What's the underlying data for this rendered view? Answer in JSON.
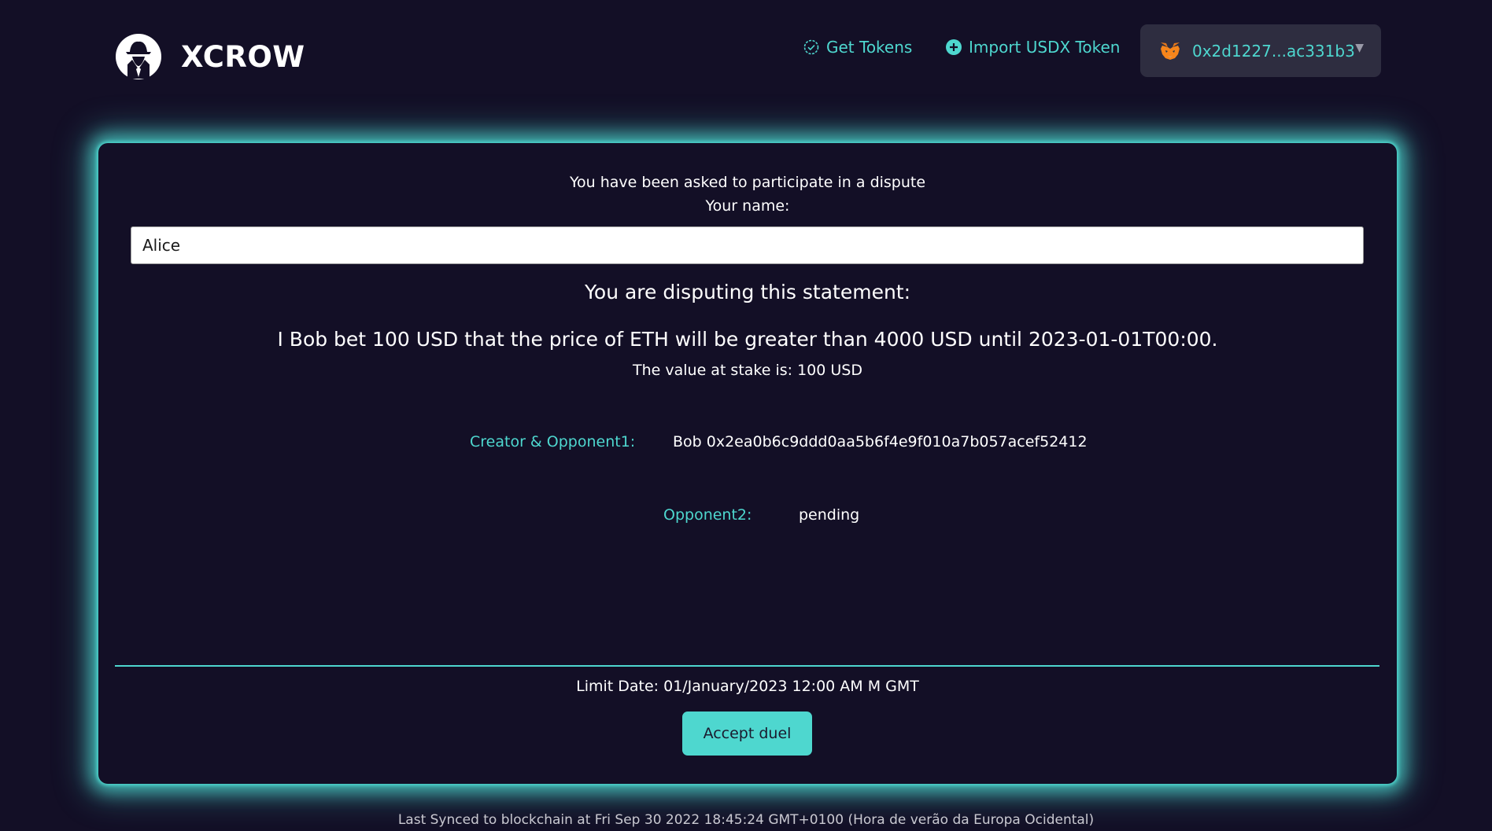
{
  "header": {
    "brand": "XCROW",
    "get_tokens_label": "Get Tokens",
    "import_token_label": "Import USDX Token",
    "wallet_address": "0x2d1227...ac331b3"
  },
  "dispute": {
    "invite_text": "You have been asked to participate in a dispute",
    "name_label": "Your name:",
    "name_value": "Alice",
    "heading": "You are disputing this statement:",
    "statement": "I Bob bet 100 USD that the price of ETH will be greater than 4000 USD until 2023-01-01T00:00.",
    "stake_text": "The value at stake is: 100 USD",
    "creator_label": "Creator & Opponent1:",
    "creator_value": "Bob 0x2ea0b6c9ddd0aa5b6f4e9f010a7b057acef52412",
    "opponent2_label": "Opponent2:",
    "opponent2_value": "pending",
    "limit_date": "Limit Date: 01/January/2023 12:00 AM M GMT",
    "accept_label": "Accept duel"
  },
  "footer": {
    "sync_text": "Last Synced to blockchain at Fri Sep 30 2022 18:45:24 GMT+0100 (Hora de verão da Europa Ocidental)"
  },
  "colors": {
    "background": "#130f26",
    "accent": "#4ed7cf",
    "wallet_bg": "#2e2d40"
  }
}
